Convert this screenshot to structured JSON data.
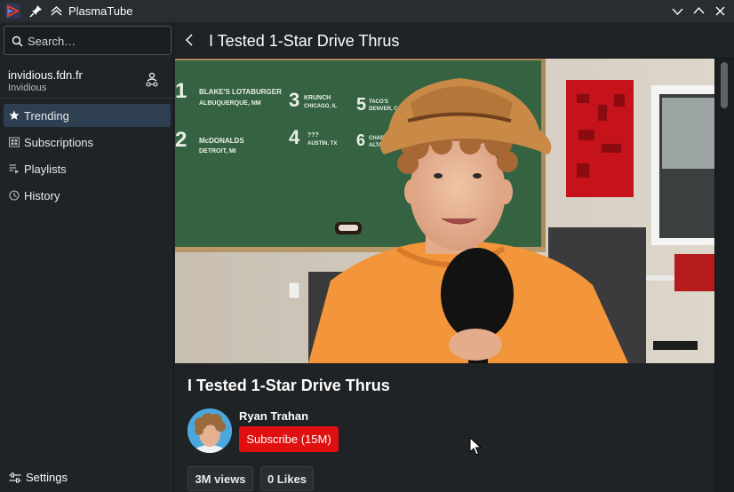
{
  "window": {
    "title": "PlasmaTube"
  },
  "sidebar": {
    "search": {
      "placeholder": "Search…"
    },
    "instance": {
      "name": "invidious.fdn.fr",
      "type": "Invidious"
    },
    "items": [
      {
        "label": "Trending",
        "icon": "star-icon",
        "active": true
      },
      {
        "label": "Subscriptions",
        "icon": "subscriptions-icon",
        "active": false
      },
      {
        "label": "Playlists",
        "icon": "playlists-icon",
        "active": false
      },
      {
        "label": "History",
        "icon": "history-icon",
        "active": false
      }
    ],
    "settings": {
      "label": "Settings",
      "icon": "settings-icon"
    }
  },
  "page": {
    "header_title": "I Tested 1-Star Drive Thrus"
  },
  "video": {
    "title": "I Tested 1-Star Drive Thrus",
    "channel": "Ryan Trahan",
    "subscribe_label": "Subscribe (15M)",
    "views": "3M views",
    "likes": "0 Likes"
  },
  "chalkboard": {
    "entries": [
      {
        "num": "1",
        "line1": "BLAKE'S LOTABURGER",
        "line2": "ALBUQUERQUE, NM"
      },
      {
        "num": "2",
        "line1": "McDONALDS",
        "line2": "DETROIT, MI"
      },
      {
        "num": "3",
        "line1": "KRUNCH",
        "line2": "CHICAGO, IL"
      },
      {
        "num": "4",
        "line1": "???",
        "line2": "AUSTIN, TX"
      },
      {
        "num": "5",
        "line1": "TACO'S",
        "line2": "DENVER, CO"
      },
      {
        "num": "6",
        "line1": "CHARLIE'S",
        "line2": "ALTANTA, GA"
      }
    ]
  },
  "colors": {
    "accent": "#2f3f52",
    "subscribe": "#e01010",
    "background": "#202326"
  }
}
